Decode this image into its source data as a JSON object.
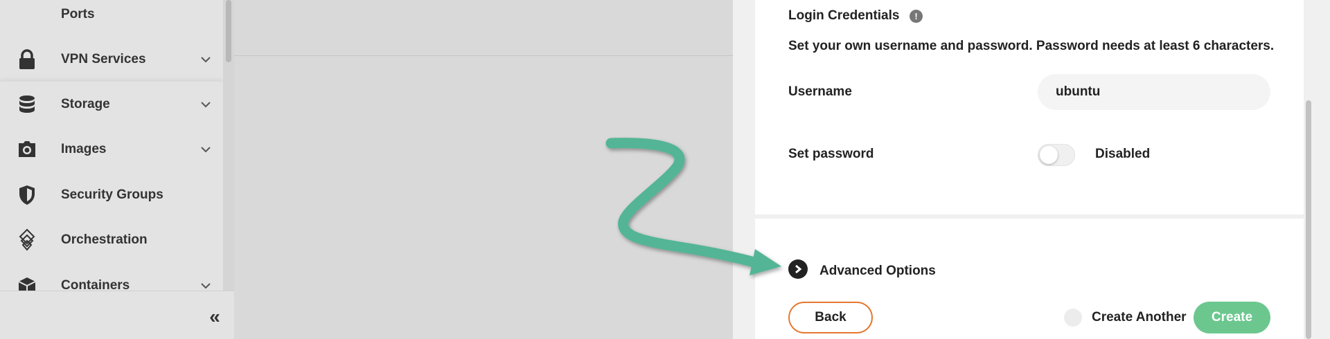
{
  "sidebar": {
    "items": [
      {
        "label": "Ports",
        "icon": "ports-icon",
        "has_chevron": false
      },
      {
        "label": "VPN Services",
        "icon": "lock-icon",
        "has_chevron": true
      },
      {
        "label": "Storage",
        "icon": "database-icon",
        "has_chevron": true
      },
      {
        "label": "Images",
        "icon": "camera-icon",
        "has_chevron": true
      },
      {
        "label": "Security Groups",
        "icon": "shield-icon",
        "has_chevron": false
      },
      {
        "label": "Orchestration",
        "icon": "orchestration-icon",
        "has_chevron": false
      },
      {
        "label": "Containers",
        "icon": "box-icon",
        "has_chevron": true
      }
    ],
    "collapse_glyph": "«"
  },
  "panel": {
    "login": {
      "title": "Login Credentials",
      "info_glyph": "!",
      "description": "Set your own username and password. Password needs at least 6 characters.",
      "username_label": "Username",
      "username_value": "ubuntu",
      "password_label": "Set password",
      "password_toggle_text": "Disabled"
    },
    "advanced_label": "Advanced Options",
    "back_label": "Back",
    "create_another_label": "Create Another",
    "create_label": "Create"
  },
  "colors": {
    "accent_orange": "#e5782f",
    "accent_green": "#6cc78f",
    "annotation_arrow": "#52b596"
  }
}
